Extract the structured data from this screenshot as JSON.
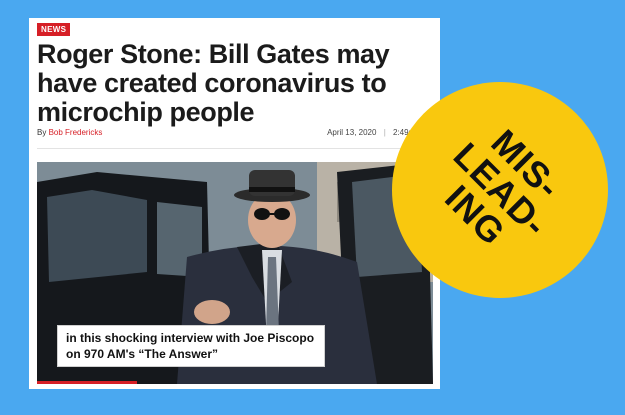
{
  "article": {
    "badge": "NEWS",
    "headline": "Roger Stone: Bill Gates may have created coronavirus to microchip people",
    "byline_prefix": "By",
    "author": "Bob Fredericks",
    "date": "April 13, 2020",
    "time": "2:49pm",
    "sep1": "|",
    "sep2": "|",
    "caption": "in this shocking interview with Joe Piscopo on 970 AM's “The Answer”"
  },
  "stamp": {
    "lines": [
      "MIS-",
      "LEAD-",
      "ING"
    ]
  },
  "colors": {
    "background": "#4aa8f0",
    "news_red": "#d61f26",
    "stamp_yellow": "#f9c80e"
  }
}
